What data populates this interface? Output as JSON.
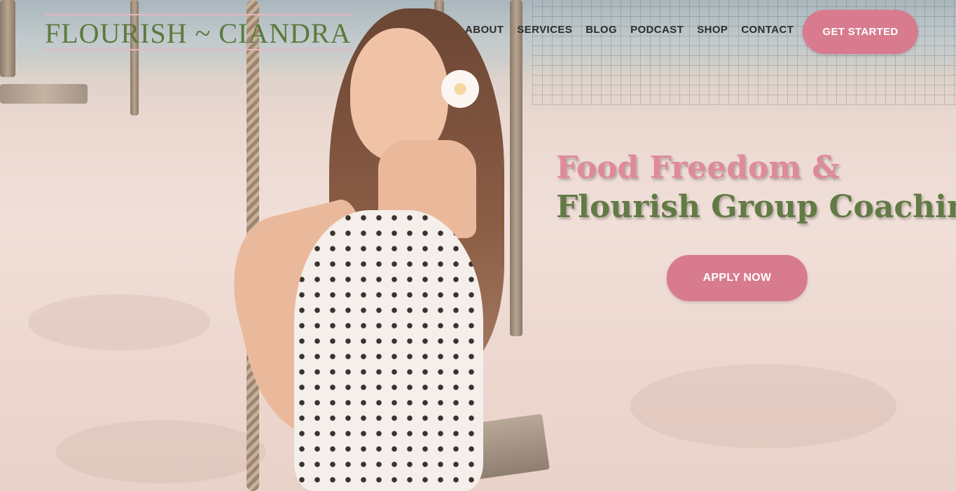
{
  "brand": {
    "logo_text": "FLOURISH ~ CIANDRA",
    "colors": {
      "pink": "#d87b8e",
      "green": "#5b7a3e",
      "text": "#2d2d2d"
    }
  },
  "nav": {
    "items": [
      "ABOUT",
      "SERVICES",
      "BLOG",
      "PODCAST",
      "SHOP",
      "CONTACT"
    ]
  },
  "header": {
    "cta_label": "GET STARTED"
  },
  "hero": {
    "headline_line1": "Food Freedom &",
    "headline_line2": "Flourish Group Coaching",
    "cta_label": "APPLY NOW",
    "image": "woman smiling on rope swing on beach"
  }
}
